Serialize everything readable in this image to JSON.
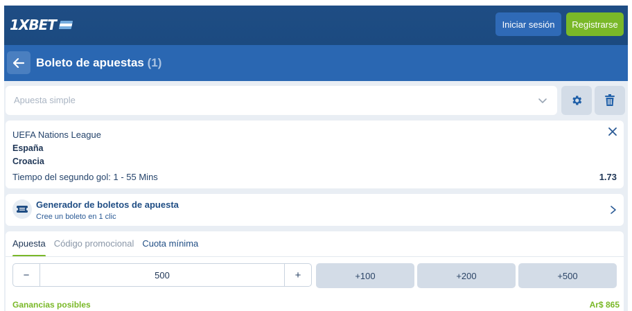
{
  "header": {
    "logo_text": "1XBET",
    "flag_colors": [
      "#74acdf",
      "#ffffff",
      "#74acdf"
    ],
    "login_label": "Iniciar sesión",
    "register_label": "Registrarse"
  },
  "titlebar": {
    "title": "Boleto de apuestas",
    "count": "(1)"
  },
  "bet_type": {
    "placeholder": "Apuesta simple"
  },
  "event": {
    "league": "UEFA Nations League",
    "team1": "España",
    "team2": "Croacia",
    "market": "Tiempo del segundo gol: 1 - 55 Mins",
    "odds": "1.73"
  },
  "generator": {
    "title": "Generador de boletos de apuesta",
    "subtitle": "Cree un boleto en 1 clic"
  },
  "bet_form": {
    "tabs": [
      {
        "label": "Apuesta",
        "active": true
      },
      {
        "label": "Código promocional",
        "active": false
      },
      {
        "label": "Cuota mínima",
        "active": false
      }
    ],
    "minus_label": "−",
    "plus_label": "+",
    "stake": "500",
    "quick_amounts": [
      "+100",
      "+200",
      "+500"
    ],
    "gain_label": "Ganancias posibles",
    "gain_value": "Ar$ 865"
  },
  "colors": {
    "header_bg": "#1f4d84",
    "titlebar_bg": "#2a67b2",
    "accent_green": "#7ab828",
    "page_bg": "#e9eef4"
  }
}
